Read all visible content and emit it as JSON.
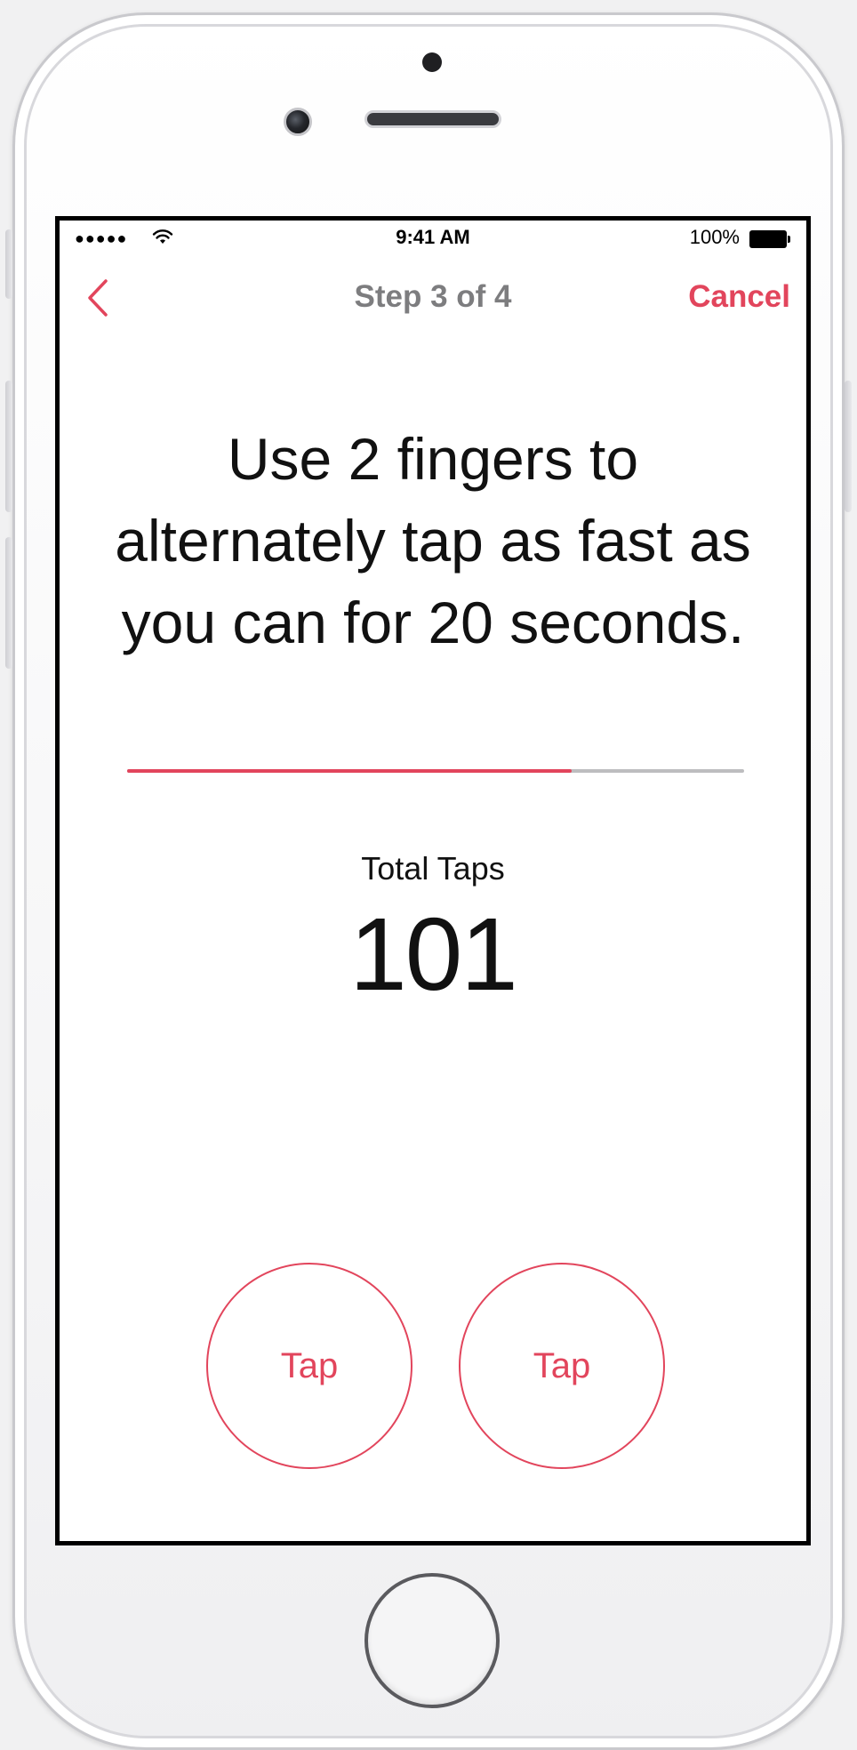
{
  "status_bar": {
    "signal": "●●●●●",
    "wifi_icon": "wifi-icon",
    "time": "9:41 AM",
    "battery_percent": "100%",
    "battery_icon": "battery-full-icon"
  },
  "nav": {
    "back_icon": "chevron-left-icon",
    "title": "Step 3 of 4",
    "cancel_label": "Cancel"
  },
  "instruction": "Use 2 fingers to alternately tap as fast as you can for 20 seconds.",
  "progress": {
    "fraction": 0.72
  },
  "taps": {
    "label": "Total Taps",
    "count": "101"
  },
  "buttons": {
    "left_label": "Tap",
    "right_label": "Tap"
  },
  "colors": {
    "accent": "#e2455c",
    "title_gray": "#7d7d7f",
    "track_gray": "#bdbdbf"
  }
}
